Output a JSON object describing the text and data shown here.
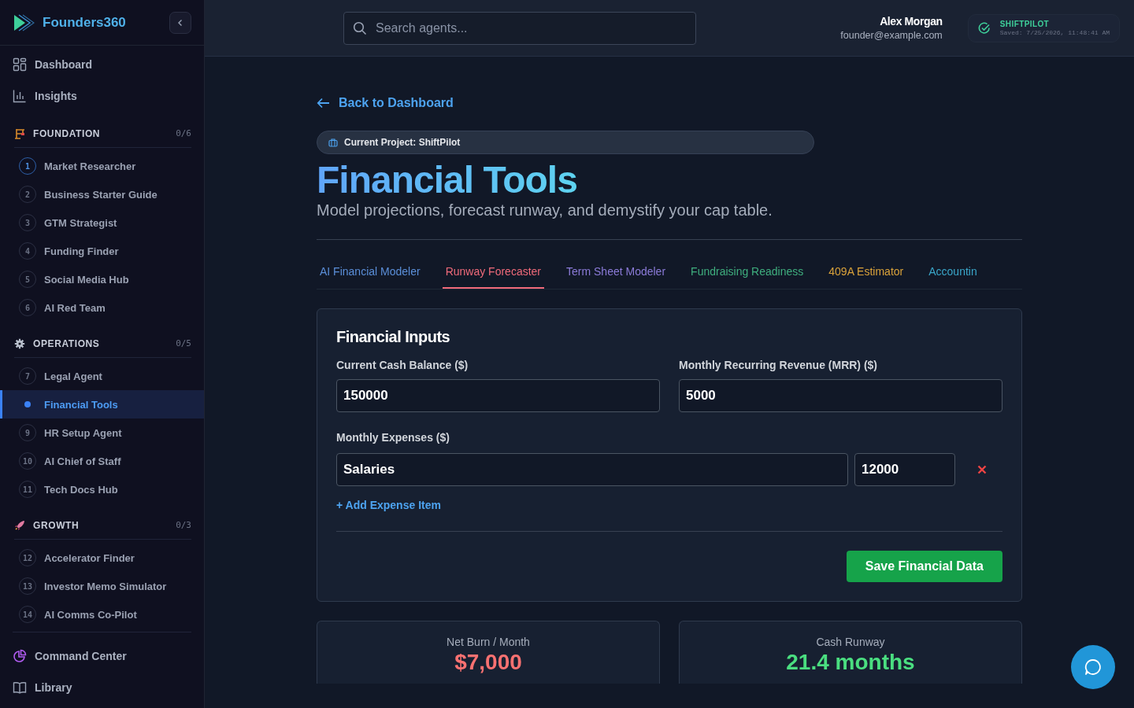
{
  "brand": {
    "name": "Founders360"
  },
  "sidebar": {
    "top_items": [
      {
        "label": "Dashboard",
        "kind": "grid"
      },
      {
        "label": "Insights",
        "kind": "chart"
      }
    ],
    "sections": [
      {
        "title": "FOUNDATION",
        "progress": "0/6",
        "items": [
          {
            "number": "1",
            "label": "Market Researcher",
            "selected": false,
            "highlighted": true
          },
          {
            "number": "2",
            "label": "Business Starter Guide",
            "selected": false,
            "highlighted": false
          },
          {
            "number": "3",
            "label": "GTM Strategist",
            "selected": false,
            "highlighted": false
          },
          {
            "number": "4",
            "label": "Funding Finder",
            "selected": false,
            "highlighted": false
          },
          {
            "number": "5",
            "label": "Social Media Hub",
            "selected": false,
            "highlighted": false
          },
          {
            "number": "6",
            "label": "AI Red Team",
            "selected": false,
            "highlighted": false
          }
        ]
      },
      {
        "title": "OPERATIONS",
        "progress": "0/5",
        "items": [
          {
            "number": "7",
            "label": "Legal Agent",
            "selected": false,
            "highlighted": false
          },
          {
            "label": "Financial Tools",
            "selected": true,
            "highlighted": false
          },
          {
            "number": "9",
            "label": "HR Setup Agent",
            "selected": false,
            "highlighted": false
          },
          {
            "number": "10",
            "label": "AI Chief of Staff",
            "selected": false,
            "highlighted": false
          },
          {
            "number": "11",
            "label": "Tech Docs Hub",
            "selected": false,
            "highlighted": false
          }
        ]
      },
      {
        "title": "GROWTH",
        "progress": "0/3",
        "items": [
          {
            "number": "12",
            "label": "Accelerator Finder",
            "selected": false,
            "highlighted": false
          },
          {
            "number": "13",
            "label": "Investor Memo Simulator",
            "selected": false,
            "highlighted": false
          },
          {
            "number": "14",
            "label": "AI Comms Co-Pilot",
            "selected": false,
            "highlighted": false
          }
        ]
      }
    ],
    "bottom_items": [
      {
        "label": "Command Center",
        "kind": "pie"
      },
      {
        "label": "Library",
        "kind": "book"
      }
    ]
  },
  "topbar": {
    "search": {
      "placeholder": "Search agents..."
    },
    "user": {
      "name": "Alex Morgan",
      "email": "founder@example.com"
    },
    "save_status": {
      "project": "SHIFTPILOT",
      "saved": "Saved: 7/25/2026, 11:48:41 AM"
    }
  },
  "page": {
    "back_link": "Back to Dashboard",
    "project_badge": "Current Project: ShiftPilot",
    "title": "Financial Tools",
    "subtitle": "Model projections, forecast runway, and demystify your cap table.",
    "tabs": [
      {
        "label": "AI Financial Modeler",
        "selected": false,
        "color": "#5b8fd9"
      },
      {
        "label": "Runway Forecaster",
        "selected": true,
        "color": "#f06a7a"
      },
      {
        "label": "Term Sheet Modeler",
        "selected": false,
        "color": "#8b7bd8"
      },
      {
        "label": "Fundraising Readiness",
        "selected": false,
        "color": "#3fae7e"
      },
      {
        "label": "409A Estimator",
        "selected": false,
        "color": "#d9a23a"
      },
      {
        "label": "Accountin",
        "selected": false,
        "color": "#3aa6c9"
      }
    ],
    "form": {
      "title": "Financial Inputs",
      "cash_label": "Current Cash Balance ($)",
      "cash_value": "150000",
      "mrr_label": "Monthly Recurring Revenue (MRR) ($)",
      "mrr_value": "5000",
      "expenses_label": "Monthly Expenses ($)",
      "expenses": [
        {
          "name": "Salaries",
          "amount": "12000"
        }
      ],
      "add_link": "+ Add Expense Item",
      "save_button": "Save Financial Data"
    },
    "metrics": [
      {
        "label": "Net Burn / Month",
        "value": "$7,000",
        "color": "#f87171"
      },
      {
        "label": "Cash Runway",
        "value": "21.4 months",
        "color": "#4ade80"
      }
    ]
  }
}
